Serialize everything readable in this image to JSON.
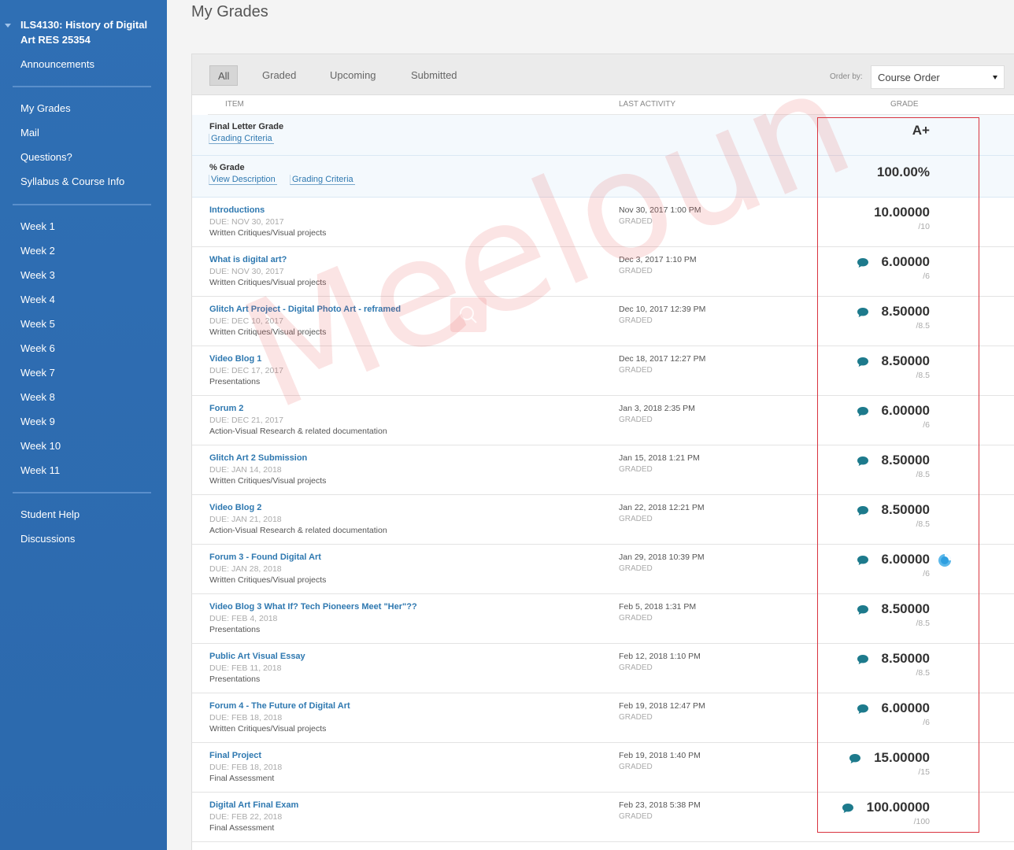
{
  "sidebar": {
    "course_title": "ILS4130: History of Digital Art RES 25354",
    "top_links": [
      "Announcements"
    ],
    "group1": [
      "My Grades",
      "Mail",
      "Questions?",
      "Syllabus & Course Info"
    ],
    "weeks": [
      "Week 1",
      "Week 2",
      "Week 3",
      "Week 4",
      "Week 5",
      "Week 6",
      "Week 7",
      "Week 8",
      "Week 9",
      "Week 10",
      "Week 11"
    ],
    "group3": [
      "Student Help",
      "Discussions"
    ]
  },
  "page": {
    "title": "My Grades"
  },
  "filters": {
    "tabs": [
      "All",
      "Graded",
      "Upcoming",
      "Submitted"
    ],
    "active": "All"
  },
  "order_by": {
    "label": "Order by:",
    "value": "Course Order"
  },
  "columns": {
    "item": "ITEM",
    "last_activity": "LAST ACTIVITY",
    "grade": "GRADE"
  },
  "summary": [
    {
      "title": "Final Letter Grade",
      "links": [
        "Grading Criteria"
      ],
      "grade": "A+"
    },
    {
      "title": "% Grade",
      "links": [
        "View Description",
        "Grading Criteria"
      ],
      "grade": "100.00%"
    }
  ],
  "items": [
    {
      "title": "Introductions",
      "due": "DUE: NOV 30, 2017",
      "category": "Written Critiques/Visual projects",
      "activity": "Nov 30, 2017 1:00 PM",
      "status": "GRADED",
      "grade": "10.00000",
      "total": "/10",
      "comment": false
    },
    {
      "title": "What is digital art?",
      "due": "DUE: NOV 30, 2017",
      "category": "Written Critiques/Visual projects",
      "activity": "Dec 3, 2017 1:10 PM",
      "status": "GRADED",
      "grade": "6.00000",
      "total": "/6",
      "comment": true
    },
    {
      "title": "Glitch Art Project - Digital Photo Art - reframed",
      "due": "DUE: DEC 10, 2017",
      "category": "Written Critiques/Visual projects",
      "activity": "Dec 10, 2017 12:39 PM",
      "status": "GRADED",
      "grade": "8.50000",
      "total": "/8.5",
      "comment": true
    },
    {
      "title": "Video Blog 1",
      "due": "DUE: DEC 17, 2017",
      "category": "Presentations",
      "activity": "Dec 18, 2017 12:27 PM",
      "status": "GRADED",
      "grade": "8.50000",
      "total": "/8.5",
      "comment": true
    },
    {
      "title": "Forum 2",
      "due": "DUE: DEC 21, 2017",
      "category": "Action-Visual Research & related documentation",
      "activity": "Jan 3, 2018 2:35 PM",
      "status": "GRADED",
      "grade": "6.00000",
      "total": "/6",
      "comment": true
    },
    {
      "title": "Glitch Art 2 Submission",
      "due": "DUE: JAN 14, 2018",
      "category": "Written Critiques/Visual projects",
      "activity": "Jan 15, 2018 1:21 PM",
      "status": "GRADED",
      "grade": "8.50000",
      "total": "/8.5",
      "comment": true
    },
    {
      "title": "Video Blog 2",
      "due": "DUE: JAN 21, 2018",
      "category": "Action-Visual Research & related documentation",
      "activity": "Jan 22, 2018 12:21 PM",
      "status": "GRADED",
      "grade": "8.50000",
      "total": "/8.5",
      "comment": true
    },
    {
      "title": "Forum 3 - Found Digital Art",
      "due": "DUE: JAN 28, 2018",
      "category": "Written Critiques/Visual projects",
      "activity": "Jan 29, 2018 10:39 PM",
      "status": "GRADED",
      "grade": "6.00000",
      "total": "/6",
      "comment": true,
      "extra_icon": true
    },
    {
      "title": "Video Blog 3 What If? Tech Pioneers Meet \"Her\"??",
      "due": "DUE: FEB 4, 2018",
      "category": "Presentations",
      "activity": "Feb 5, 2018 1:31 PM",
      "status": "GRADED",
      "grade": "8.50000",
      "total": "/8.5",
      "comment": true
    },
    {
      "title": "Public Art Visual Essay",
      "due": "DUE: FEB 11, 2018",
      "category": "Presentations",
      "activity": "Feb 12, 2018 1:10 PM",
      "status": "GRADED",
      "grade": "8.50000",
      "total": "/8.5",
      "comment": true
    },
    {
      "title": "Forum 4 - The Future of Digital Art",
      "due": "DUE: FEB 18, 2018",
      "category": "Written Critiques/Visual projects",
      "activity": "Feb 19, 2018 12:47 PM",
      "status": "GRADED",
      "grade": "6.00000",
      "total": "/6",
      "comment": true
    },
    {
      "title": "Final Project",
      "due": "DUE: FEB 18, 2018",
      "category": "Final Assessment",
      "activity": "Feb 19, 2018 1:40 PM",
      "status": "GRADED",
      "grade": "15.00000",
      "total": "/15",
      "comment": true
    },
    {
      "title": "Digital Art Final Exam",
      "due": "DUE: FEB 22, 2018",
      "category": "Final Assessment",
      "activity": "Feb 23, 2018 5:38 PM",
      "status": "GRADED",
      "grade": "100.00000",
      "total": "/100",
      "comment": true
    }
  ],
  "watermark": "Meeloun",
  "icons": {
    "comment": "speech-bubble-icon",
    "status": "progress-circle-icon",
    "search": "search-icon"
  },
  "colors": {
    "sidebar": "#2c69ad",
    "link": "#2e78b0",
    "highlight": "#d9343f",
    "comment_icon": "#1d7a8c"
  }
}
